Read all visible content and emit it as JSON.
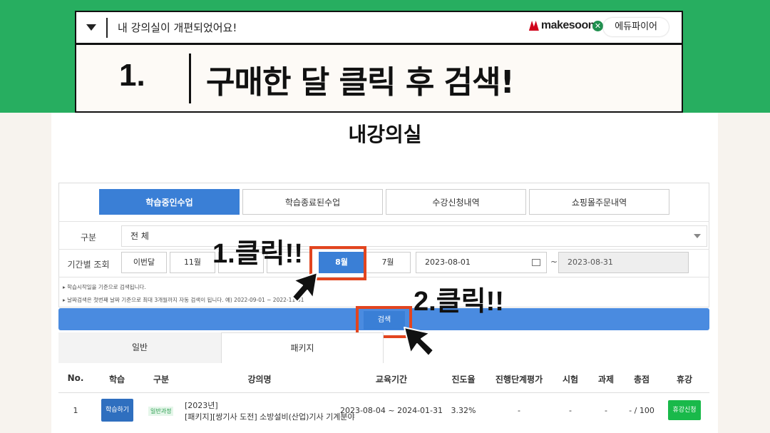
{
  "banner": {
    "notice": "내 강의실이 개편되었어요!",
    "brand": "makesoon",
    "partner": "에듀파이어",
    "step_number": "1.",
    "step_title": "구매한 달 클릭 후 검색!"
  },
  "page": {
    "title": "내강의실"
  },
  "tabs": [
    {
      "label": "학습중인수업",
      "active": true
    },
    {
      "label": "학습종료된수업",
      "active": false
    },
    {
      "label": "수강신청내역",
      "active": false
    },
    {
      "label": "쇼핑몰주문내역",
      "active": false
    }
  ],
  "filter": {
    "category_label": "구분",
    "category_value": "전 체",
    "period_label": "기간별 조회",
    "months": [
      "이번달",
      "11월",
      "",
      "",
      "8월",
      "7월"
    ],
    "selected_month": "8월",
    "start_date": "2023-08-01",
    "end_date": "2023-08-31",
    "tilde": "~",
    "notes": [
      "▸ 학습시작일을 기준으로 검색됩니다.",
      "▸ 날짜검색은 첫번째 날짜 기준으로 최대 3개월까지 자동 검색이 됩니다. 예) 2022-09-01 ~ 2022-11-01"
    ],
    "search_label": "검색"
  },
  "annotations": {
    "click1": "1.클릭!!",
    "click2": "2.클릭!!"
  },
  "subtabs": [
    "일반",
    "패키지"
  ],
  "table": {
    "headers": [
      "No.",
      "학습",
      "구분",
      "강의명",
      "교육기간",
      "진도율",
      "진행단계평가",
      "시험",
      "과제",
      "총점",
      "휴강"
    ],
    "rows": [
      {
        "no": "1",
        "study_btn": "학습하기",
        "type": "일반과정",
        "name_line1": "[2023년]",
        "name_line2": "[패키지][쌍기사 도전] 소방설비(산업)기사 기계분야",
        "period": "2023-08-04 ~ 2024-01-31",
        "progress": "3.32%",
        "stage_eval": "-",
        "exam": "-",
        "assignment": "-",
        "total": "- / 100",
        "break_btn": "휴강신청"
      }
    ]
  },
  "colors": {
    "green_band": "#27ae60",
    "tab_active": "#3a7fd6",
    "highlight_frame": "#e2451f",
    "break_button": "#19b94a"
  }
}
